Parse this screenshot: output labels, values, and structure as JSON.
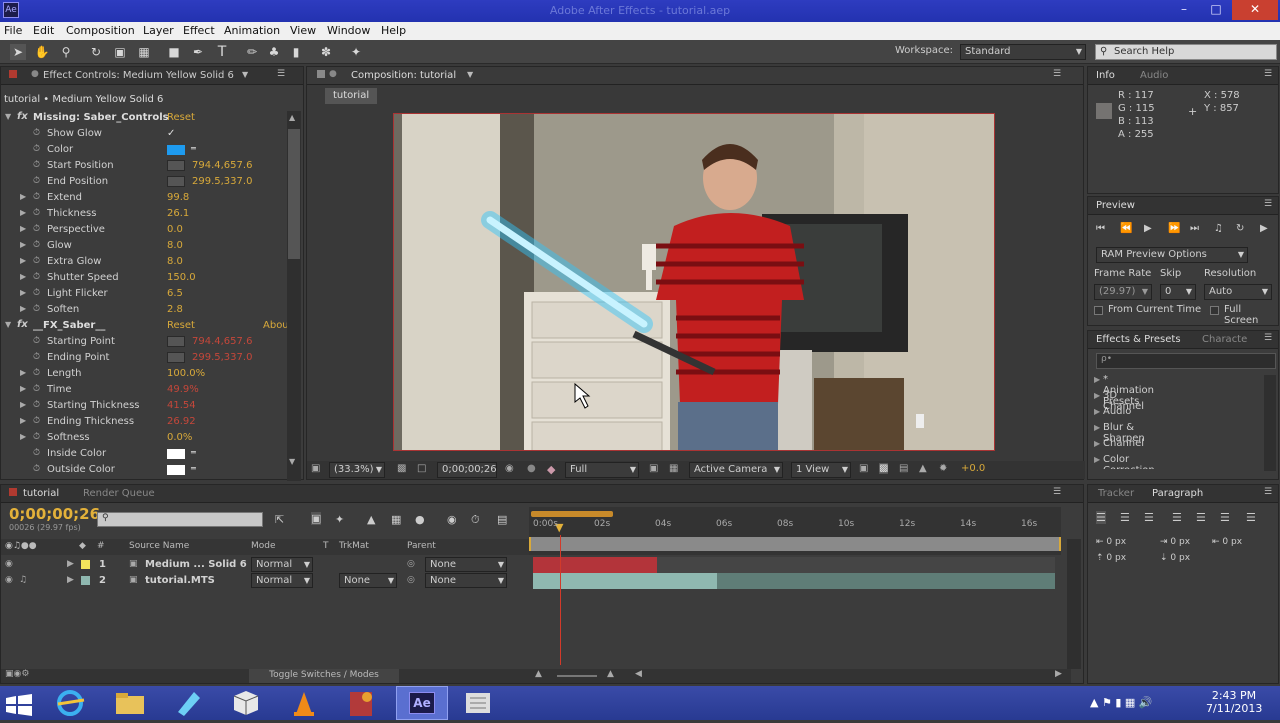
{
  "window": {
    "title": "Adobe After Effects - tutorial.aep",
    "app_icon": "Ae"
  },
  "menu": [
    "File",
    "Edit",
    "Composition",
    "Layer",
    "Effect",
    "Animation",
    "View",
    "Window",
    "Help"
  ],
  "toolbar": {
    "workspace_label": "Workspace:",
    "workspace_value": "Standard",
    "search_placeholder": "Search Help"
  },
  "effect_controls": {
    "tab": "Effect Controls: Medium Yellow Solid 6",
    "layer_path": "tutorial • Medium Yellow Solid 6",
    "effects": [
      {
        "name": "Missing: Saber_Controls",
        "reset": "Reset",
        "about": ""
      },
      {
        "name": "__FX_Saber__",
        "reset": "Reset",
        "about": "Abou"
      }
    ],
    "saber_props": [
      {
        "name": "Show Glow",
        "value": "✓",
        "kind": "check"
      },
      {
        "name": "Color",
        "value": "",
        "kind": "swatch",
        "color": "#1e9bef"
      },
      {
        "name": "Start Position",
        "value": "794.4,657.6",
        "kind": "point"
      },
      {
        "name": "End Position",
        "value": "299.5,337.0",
        "kind": "point"
      },
      {
        "name": "Extend",
        "value": "99.8",
        "kind": "num"
      },
      {
        "name": "Thickness",
        "value": "26.1",
        "kind": "num"
      },
      {
        "name": "Perspective",
        "value": "0.0",
        "kind": "num"
      },
      {
        "name": "Glow",
        "value": "8.0",
        "kind": "num"
      },
      {
        "name": "Extra Glow",
        "value": "8.0",
        "kind": "num"
      },
      {
        "name": "Shutter Speed",
        "value": "150.0",
        "kind": "num"
      },
      {
        "name": "Light Flicker",
        "value": "6.5",
        "kind": "num"
      },
      {
        "name": "Soften",
        "value": "2.8",
        "kind": "num"
      }
    ],
    "fx_props": [
      {
        "name": "Starting Point",
        "value": "794.4,657.6",
        "kind": "point"
      },
      {
        "name": "Ending Point",
        "value": "299.5,337.0",
        "kind": "point"
      },
      {
        "name": "Length",
        "value": "100.0%",
        "kind": "num"
      },
      {
        "name": "Time",
        "value": "49.9%",
        "kind": "numred"
      },
      {
        "name": "Starting Thickness",
        "value": "41.54",
        "kind": "numred"
      },
      {
        "name": "Ending Thickness",
        "value": "26.92",
        "kind": "numred"
      },
      {
        "name": "Softness",
        "value": "0.0%",
        "kind": "num"
      },
      {
        "name": "Inside Color",
        "value": "",
        "kind": "swatch",
        "color": "#ffffff"
      },
      {
        "name": "Outside Color",
        "value": "",
        "kind": "swatch",
        "color": "#ffffff"
      }
    ]
  },
  "composition": {
    "tab": "Composition: tutorial",
    "subtab": "tutorial",
    "zoom": "(33.3%)",
    "timecode": "0;00;00;26",
    "resolution": "Full",
    "camera": "Active Camera",
    "view": "1 View",
    "exposure": "+0.0"
  },
  "info": {
    "tab": "Info",
    "tab2": "Audio",
    "r": "R : 117",
    "g": "G : 115",
    "b": "B : 113",
    "a": "A : 255",
    "x": "X : 578",
    "y": "Y : 857"
  },
  "preview": {
    "tab": "Preview",
    "ram_options": "RAM Preview Options",
    "frame_rate_label": "Frame Rate",
    "skip_label": "Skip",
    "resolution_label": "Resolution",
    "frame_rate": "(29.97)",
    "skip": "0",
    "resolution": "Auto",
    "from_current": "From Current Time",
    "full_screen": "Full Screen"
  },
  "effects_presets": {
    "tab": "Effects & Presets",
    "tab2": "Characte",
    "search_placeholder": "ρ•",
    "items": [
      "* Animation Presets",
      "3D Channel",
      "Audio",
      "Blur & Sharpen",
      "Channel",
      "Color Correction"
    ]
  },
  "timeline": {
    "tab": "tutorial",
    "tab2": "Render Queue",
    "timecode": "0;00;00;26",
    "fps": "00026 (29.97 fps)",
    "columns": {
      "source": "Source Name",
      "mode": "Mode",
      "t": "T",
      "trkmat": "TrkMat",
      "parent": "Parent"
    },
    "ruler": [
      "0:00s",
      "02s",
      "04s",
      "06s",
      "08s",
      "10s",
      "12s",
      "14s",
      "16s"
    ],
    "layers": [
      {
        "num": "1",
        "name": "Medium ... Solid 6",
        "mode": "Normal",
        "trkmat": "",
        "parent": "None",
        "label_color": "#f2e45c"
      },
      {
        "num": "2",
        "name": "tutorial.MTS",
        "mode": "Normal",
        "trkmat": "None",
        "parent": "None",
        "label_color": "#8fb8b0"
      }
    ],
    "toggle": "Toggle Switches / Modes"
  },
  "paragraph": {
    "tab": "Tracker",
    "tab2": "Paragraph",
    "values": [
      "0 px",
      "0 px",
      "0 px",
      "0 px",
      "0 px"
    ]
  },
  "taskbar": {
    "time": "2:43 PM",
    "date": "7/11/2013"
  }
}
